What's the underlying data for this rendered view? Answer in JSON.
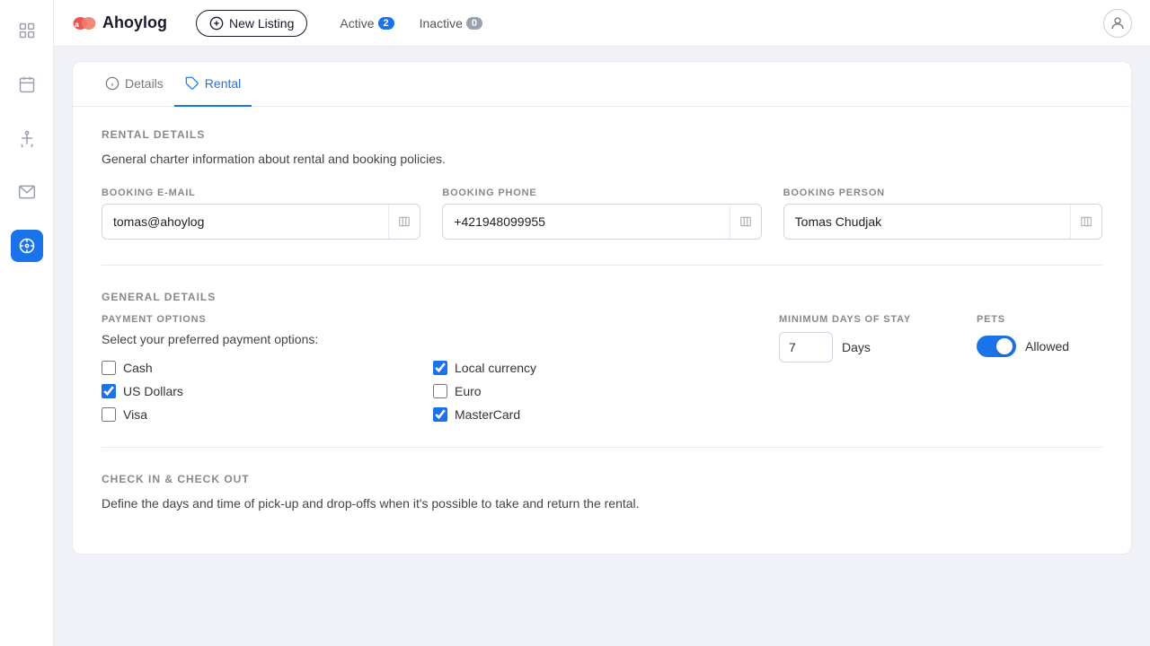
{
  "app": {
    "logo_text": "Ahoylog"
  },
  "navbar": {
    "new_listing_label": "New Listing",
    "active_label": "Active",
    "active_count": "2",
    "inactive_label": "Inactive",
    "inactive_count": "0"
  },
  "sidebar": {
    "items": [
      {
        "name": "dashboard",
        "label": "Dashboard"
      },
      {
        "name": "calendar",
        "label": "Calendar"
      },
      {
        "name": "anchor",
        "label": "Anchor"
      },
      {
        "name": "mail",
        "label": "Mail"
      },
      {
        "name": "compass",
        "label": "Compass",
        "active": true
      }
    ]
  },
  "card": {
    "tab_details": "Details",
    "tab_rental": "Rental"
  },
  "rental_details": {
    "section_title": "RENTAL DETAILS",
    "section_desc": "General charter information about rental and booking policies.",
    "booking_email_label": "BOOKING E-MAIL",
    "booking_email_value": "tomas@ahoylog",
    "booking_phone_label": "BOOKING PHONE",
    "booking_phone_value": "+421948099955",
    "booking_person_label": "BOOKING PERSON",
    "booking_person_value": "Tomas Chudjak"
  },
  "general_details": {
    "section_title": "GENERAL DETAILS",
    "payment_options_label": "PAYMENT OPTIONS",
    "payment_options_desc": "Select your preferred payment options:",
    "checkboxes": [
      {
        "label": "Cash",
        "checked": false
      },
      {
        "label": "Local currency",
        "checked": true
      },
      {
        "label": "US Dollars",
        "checked": true
      },
      {
        "label": "Euro",
        "checked": false
      },
      {
        "label": "Visa",
        "checked": false
      },
      {
        "label": "MasterCard",
        "checked": true
      }
    ],
    "min_days_label": "MINIMUM DAYS OF STAY",
    "min_days_value": "7",
    "days_text": "Days",
    "pets_label": "PETS",
    "pets_allowed_text": "Allowed",
    "pets_enabled": true
  },
  "check_section": {
    "title": "CHECK IN & CHECK OUT",
    "desc": "Define the days and time of pick-up and drop-offs when it's possible to take and return the rental."
  }
}
